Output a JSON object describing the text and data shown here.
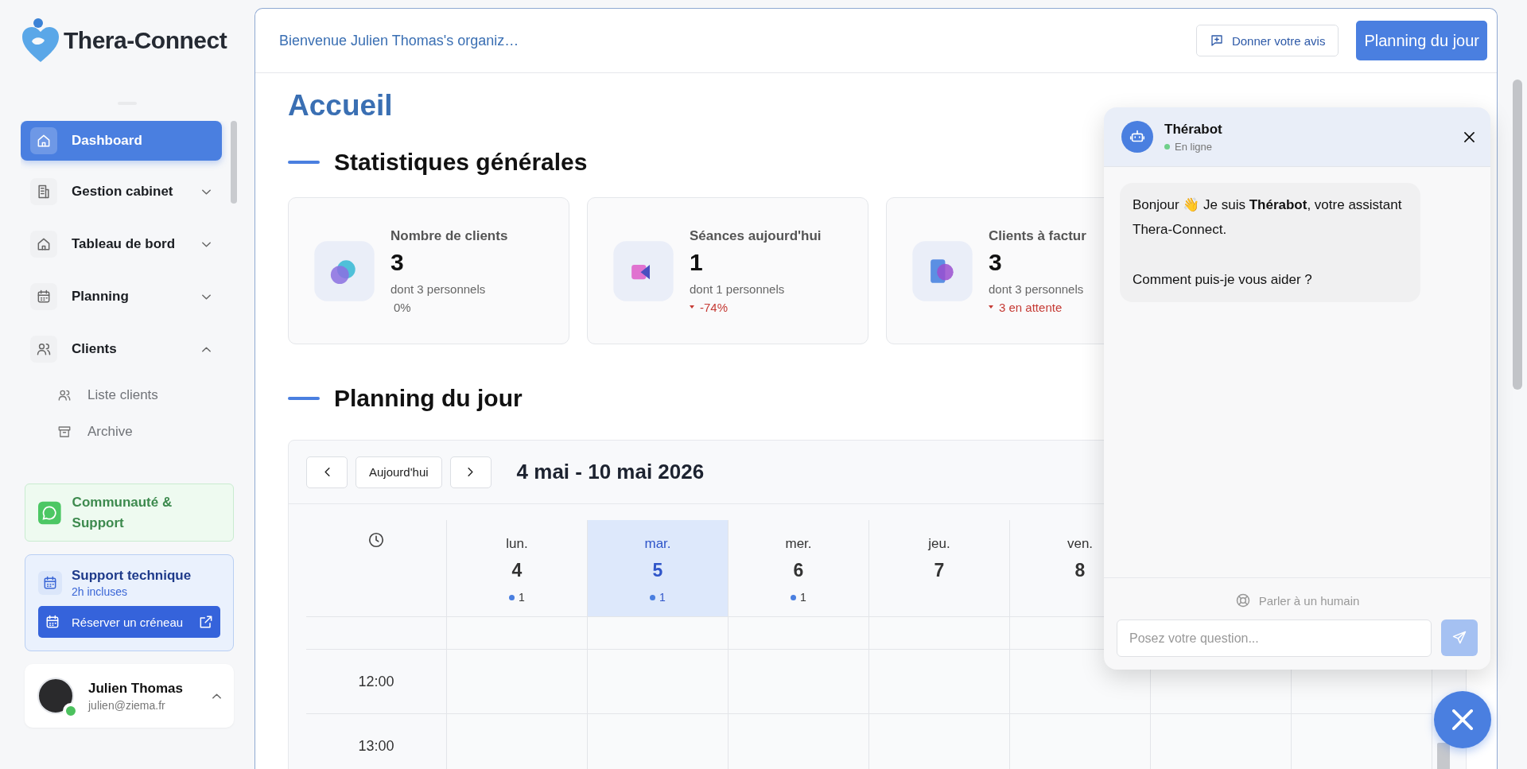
{
  "logo": {
    "text": "Thera-Connect"
  },
  "sidebar": {
    "items": [
      {
        "label": "Dashboard",
        "kind": "link",
        "selected": true
      },
      {
        "label": "Gestion cabinet",
        "kind": "group",
        "selected": false,
        "expanded": false
      },
      {
        "label": "Tableau de bord",
        "kind": "group",
        "selected": false,
        "expanded": false
      },
      {
        "label": "Planning",
        "kind": "group",
        "selected": false,
        "expanded": false
      },
      {
        "label": "Clients",
        "kind": "group",
        "selected": false,
        "expanded": true,
        "children": [
          {
            "label": "Liste clients",
            "selected": false
          },
          {
            "label": "Archive",
            "selected": false
          }
        ]
      }
    ]
  },
  "community": {
    "label": "Communauté & Support"
  },
  "support": {
    "title": "Support technique",
    "subtitle": "2h incluses",
    "button": "Réserver un créneau"
  },
  "user": {
    "name": "Julien Thomas",
    "email": "julien@ziema.fr",
    "online": true
  },
  "header": {
    "welcome": "Bienvenue Julien Thomas's organiz…",
    "buttons": [
      {
        "label": "Donner votre avis",
        "kind": "secondary"
      },
      {
        "label": "Planning du jour",
        "kind": "primary"
      }
    ]
  },
  "page_title": "Accueil",
  "stats": {
    "title": "Statistiques générales",
    "cards": [
      {
        "label": "Nombre de clients",
        "value": "3",
        "detail": "dont 3 personnels",
        "trend": "0%",
        "trend_down": false
      },
      {
        "label": "Séances aujourd'hui",
        "value": "1",
        "detail": "dont 1 personnels",
        "trend": "-74%",
        "trend_down": true
      },
      {
        "label": "Clients à factur",
        "value": "3",
        "detail": "dont 3 personnels",
        "trend": "3 en attente",
        "trend_down": true
      }
    ]
  },
  "planning": {
    "title": "Planning du jour",
    "today": "Aujourd'hui",
    "range": "4 mai - 10 mai 2026",
    "days": [
      {
        "name": "lun.",
        "number": "4",
        "count": "1",
        "selected": false
      },
      {
        "name": "mar.",
        "number": "5",
        "count": "1",
        "selected": true
      },
      {
        "name": "mer.",
        "number": "6",
        "count": "1",
        "selected": false
      },
      {
        "name": "jeu.",
        "number": "7",
        "selected": false
      },
      {
        "name": "ven.",
        "number": "8",
        "selected": false
      }
    ],
    "times": [
      "12:00",
      "13:00"
    ]
  },
  "chat": {
    "title": "Thérabot",
    "status": "En ligne",
    "online": true,
    "messages": [
      {
        "text": "Bonjour 👋 Je suis **Thérabot**, votre assistant Thera-Connect.\n\nComment puis-je vous aider ?"
      }
    ],
    "human_link": "Parler à un humain",
    "placeholder": "Posez votre question..."
  }
}
